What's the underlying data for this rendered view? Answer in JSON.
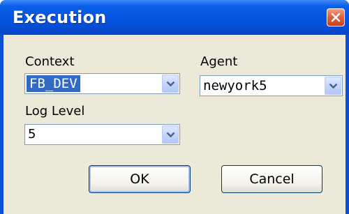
{
  "window": {
    "title": "Execution"
  },
  "context": {
    "label": "Context",
    "value": "FB_DEV"
  },
  "agent": {
    "label": "Agent",
    "value": "newyork5"
  },
  "log_level": {
    "label": "Log Level",
    "value": "5"
  },
  "buttons": {
    "ok": "OK",
    "cancel": "Cancel"
  },
  "colors": {
    "title_bar": "#0553e0",
    "dialog_bg": "#ece9d8",
    "selection": "#316ac5",
    "close_button": "#e0633e"
  },
  "icons": {
    "close": "close-icon",
    "dropdown": "chevron-down-icon"
  }
}
